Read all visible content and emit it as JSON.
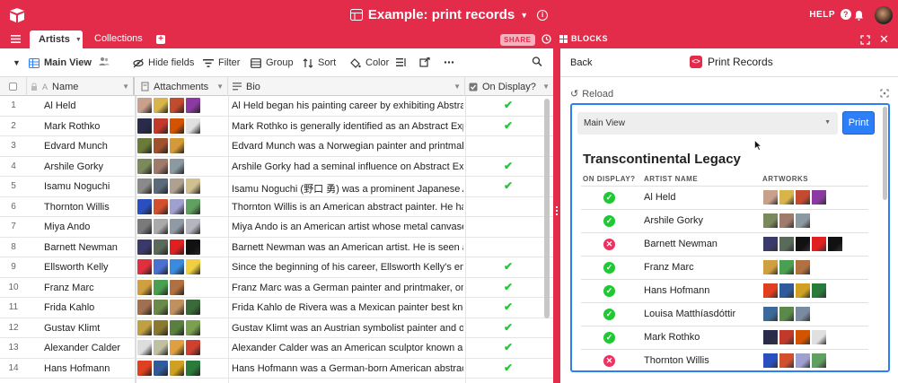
{
  "app": {
    "title": "Example: print records",
    "help_label": "HELP",
    "tabs": [
      {
        "label": "Artists",
        "active": true
      },
      {
        "label": "Collections",
        "active": false
      }
    ],
    "share_label": "SHARE",
    "blocks_label": "BLOCKS",
    "accent_color": "#e32b4a"
  },
  "toolbar": {
    "view_name": "Main View",
    "hide_fields": "Hide fields",
    "filter": "Filter",
    "group": "Group",
    "sort": "Sort",
    "color": "Color",
    "icons": [
      "people-icon",
      "row-height-icon",
      "share-view-icon",
      "more-icon",
      "search-icon"
    ]
  },
  "columns": [
    "Name",
    "Attachments",
    "Bio",
    "On Display?"
  ],
  "rows": [
    {
      "num": "1",
      "name": "Al Held",
      "bio": "Al Held began his painting career by exhibiting Abstract Ex...",
      "on_display": true,
      "thumbs": [
        "#c9a08c",
        "#d8b54a",
        "#c24a2e",
        "#8a3aa0"
      ]
    },
    {
      "num": "2",
      "name": "Mark Rothko",
      "bio": "Mark Rothko is generally identified as an Abstract Expressi...",
      "on_display": true,
      "thumbs": [
        "#2a2a4a",
        "#c0392b",
        "#d35400",
        "#e0e0e0"
      ]
    },
    {
      "num": "3",
      "name": "Edvard Munch",
      "bio": "Edvard Munch was a Norwegian painter and printmaker w...",
      "on_display": false,
      "thumbs": [
        "#6b7a3a",
        "#a0522d",
        "#d49a3a"
      ]
    },
    {
      "num": "4",
      "name": "Arshile Gorky",
      "bio": "Arshile Gorky had a seminal influence on Abstract Express...",
      "on_display": true,
      "thumbs": [
        "#7b8a5a",
        "#a07a6a",
        "#8a9aa0"
      ]
    },
    {
      "num": "5",
      "name": "Isamu Noguchi",
      "bio": "Isamu Noguchi (野口 勇) was a prominent Japanese Ameri...",
      "on_display": true,
      "thumbs": [
        "#8a8a8a",
        "#5a6a7a",
        "#b0a090",
        "#d0c090"
      ]
    },
    {
      "num": "6",
      "name": "Thornton Willis",
      "bio": "Thornton Willis is an American abstract painter. He has co...",
      "on_display": false,
      "thumbs": [
        "#2a50c0",
        "#d05030",
        "#a0a0d0",
        "#60a060"
      ]
    },
    {
      "num": "7",
      "name": "Miya Ando",
      "bio": "Miya Ando is an American artist whose metal canvases an...",
      "on_display": false,
      "thumbs": [
        "#7a7a7a",
        "#aaaaaa",
        "#909aa5",
        "#b5b5c0"
      ]
    },
    {
      "num": "8",
      "name": "Barnett Newman",
      "bio": "Barnett Newman was an American artist. He is seen as on...",
      "on_display": false,
      "thumbs": [
        "#3a3a6a",
        "#5a6a5a",
        "#e02020",
        "#111111"
      ]
    },
    {
      "num": "9",
      "name": "Ellsworth Kelly",
      "bio": "Since the beginning of his career, Ellsworth Kelly's empha...",
      "on_display": true,
      "thumbs": [
        "#e03040",
        "#4a70d0",
        "#3a8ae0",
        "#f0d040"
      ]
    },
    {
      "num": "10",
      "name": "Franz Marc",
      "bio": "Franz Marc was a German painter and printmaker, one of t...",
      "on_display": true,
      "thumbs": [
        "#d0a040",
        "#4aa050",
        "#b07040"
      ]
    },
    {
      "num": "11",
      "name": "Frida Kahlo",
      "bio": "Frida Kahlo de Rivera was a Mexican painter best known fo...",
      "on_display": true,
      "thumbs": [
        "#a07050",
        "#6a8a4a",
        "#c09060",
        "#3a6a3a"
      ]
    },
    {
      "num": "12",
      "name": "Gustav Klimt",
      "bio": "Gustav Klimt was an Austrian symbolist painter and one of ...",
      "on_display": true,
      "thumbs": [
        "#c0a040",
        "#8a7a30",
        "#5a8040",
        "#7aa050"
      ]
    },
    {
      "num": "13",
      "name": "Alexander Calder",
      "bio": "Alexander Calder was an American sculptor known as the ...",
      "on_display": true,
      "thumbs": [
        "#dddddd",
        "#c0c0a0",
        "#e0a040",
        "#d04030"
      ]
    },
    {
      "num": "14",
      "name": "Hans Hofmann",
      "bio": "Hans Hofmann was a German-born American abstract exp...",
      "on_display": true,
      "thumbs": [
        "#e04020",
        "#305a9a",
        "#d0a020",
        "#2a7a3a"
      ]
    }
  ],
  "panel": {
    "back_label": "Back",
    "title": "Print Records",
    "reload_label": "Reload",
    "view_select_value": "Main View",
    "print_label": "Print",
    "list_title": "Transcontinental Legacy",
    "list_headers": [
      "ON DISPLAY?",
      "ARTIST NAME",
      "ARTWORKS"
    ],
    "records": [
      {
        "name": "Al Held",
        "on_display": true,
        "thumbs": [
          "#c9a08c",
          "#d8b54a",
          "#c24a2e",
          "#8a3aa0"
        ]
      },
      {
        "name": "Arshile Gorky",
        "on_display": true,
        "thumbs": [
          "#7b8a5a",
          "#a07a6a",
          "#8a9aa0"
        ]
      },
      {
        "name": "Barnett Newman",
        "on_display": false,
        "thumbs": [
          "#3a3a6a",
          "#5a6a5a",
          "#111111",
          "#e02020",
          "#111111"
        ]
      },
      {
        "name": "Franz Marc",
        "on_display": true,
        "thumbs": [
          "#d0a040",
          "#4aa050",
          "#b07040"
        ]
      },
      {
        "name": "Hans Hofmann",
        "on_display": true,
        "thumbs": [
          "#e04020",
          "#305a9a",
          "#d0a020",
          "#2a7a3a"
        ]
      },
      {
        "name": "Louisa Matthíasdóttir",
        "on_display": true,
        "thumbs": [
          "#3a6a9a",
          "#5a8a4a",
          "#7a8aa0"
        ]
      },
      {
        "name": "Mark Rothko",
        "on_display": true,
        "thumbs": [
          "#2a2a4a",
          "#c0392b",
          "#d35400",
          "#e0e0e0"
        ]
      },
      {
        "name": "Thornton Willis",
        "on_display": false,
        "thumbs": [
          "#2a50c0",
          "#d05030",
          "#a0a0d0",
          "#60a060"
        ]
      }
    ]
  }
}
